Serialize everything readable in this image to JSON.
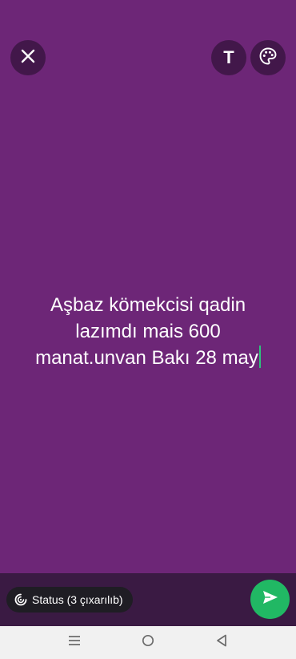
{
  "header": {
    "close_icon": "close-icon",
    "text_tool_label": "T",
    "palette_icon": "palette-icon"
  },
  "status": {
    "text": "Aşbaz kömekcisi qadin lazımdı mais 600 manat.unvan Bakı 28 may",
    "background_color": "#6d2677",
    "caret_color": "#2ec27e"
  },
  "footer": {
    "audience_label": "Status (3 çıxarılıb)",
    "audience_icon": "status-ring-icon",
    "send_icon": "send-icon",
    "send_color": "#21b864"
  },
  "system_nav": {
    "menu_icon": "recent-apps-icon",
    "home_icon": "home-icon",
    "back_icon": "back-icon"
  }
}
